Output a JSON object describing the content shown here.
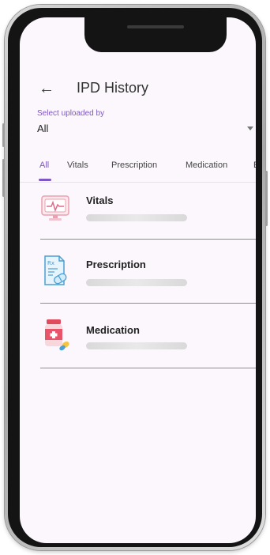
{
  "header": {
    "title": "IPD History",
    "back_icon": "arrow-left-icon"
  },
  "filter": {
    "label": "Select uploaded by",
    "value": "All"
  },
  "tabs": [
    {
      "label": "All",
      "active": true
    },
    {
      "label": "Vitals",
      "active": false
    },
    {
      "label": "Prescription",
      "active": false
    },
    {
      "label": "Medication",
      "active": false
    },
    {
      "label": "E",
      "active": false
    }
  ],
  "items": [
    {
      "label": "Vitals",
      "icon": "vitals-monitor-icon"
    },
    {
      "label": "Prescription",
      "icon": "prescription-document-icon"
    },
    {
      "label": "Medication",
      "icon": "medicine-bottle-icon"
    }
  ],
  "colors": {
    "accent": "#7e57c2",
    "screen_background": "#fbf7fc"
  }
}
